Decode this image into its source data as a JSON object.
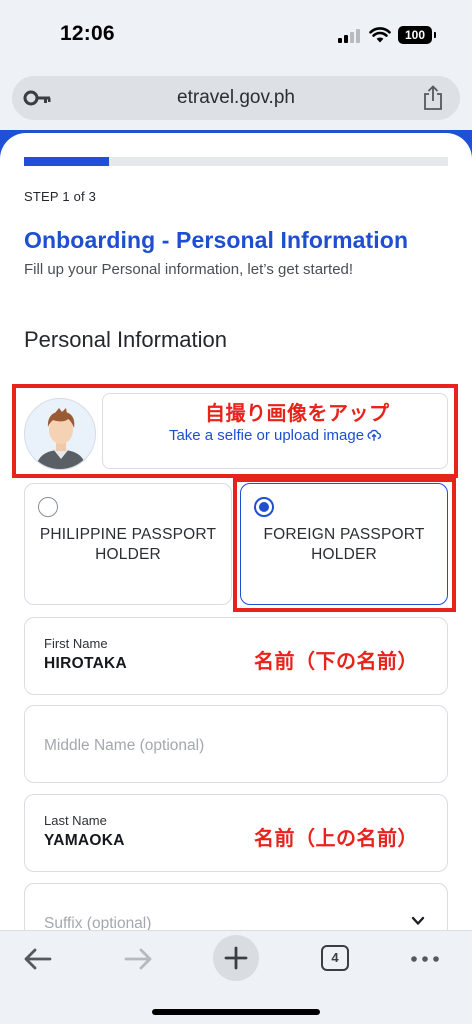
{
  "status_bar": {
    "time": "12:06",
    "battery": "100",
    "icons": [
      "cellular-signal-icon",
      "wifi-icon",
      "battery-icon"
    ]
  },
  "browser": {
    "url": "etravel.gov.ph",
    "icons": [
      "key-icon",
      "share-icon"
    ]
  },
  "form": {
    "progress_fraction": 0.2,
    "step_label": "STEP 1 of 3",
    "title": "Onboarding - Personal Information",
    "subtitle": "Fill up your Personal information, let’s get started!",
    "section_title": "Personal Information",
    "selfie": {
      "upload_label": "Take a selfie or upload image"
    },
    "passport_options": [
      {
        "label": "PHILIPPINE PASSPORT HOLDER",
        "selected": false
      },
      {
        "label": "FOREIGN PASSPORT HOLDER",
        "selected": true
      }
    ],
    "first_name": {
      "label": "First Name",
      "value": "HIROTAKA"
    },
    "middle_name": {
      "placeholder": "Middle Name (optional)"
    },
    "last_name": {
      "label": "Last Name",
      "value": "YAMAOKA"
    },
    "suffix": {
      "placeholder": "Suffix (optional)"
    }
  },
  "annotations": {
    "selfie_note": "自撮り画像をアップ",
    "first_name_note": "名前（下の名前）",
    "last_name_note": "名前（上の名前）"
  },
  "toolbar": {
    "tab_count": "4",
    "icons": [
      "back-arrow-icon",
      "forward-arrow-icon",
      "plus-icon",
      "tabs-icon",
      "more-icon"
    ]
  },
  "colors": {
    "brand_blue": "#1e4fd0",
    "annotation_red": "#e8231b"
  }
}
